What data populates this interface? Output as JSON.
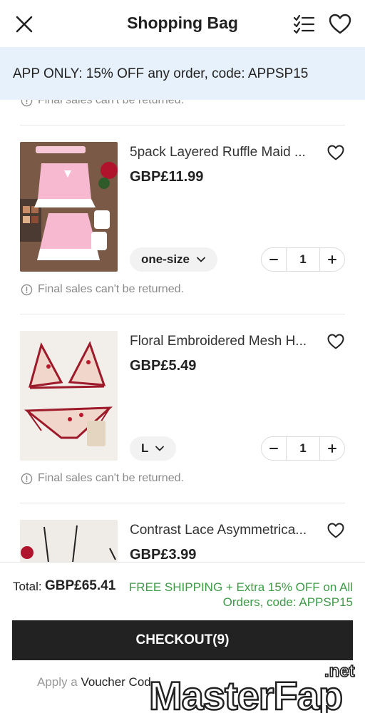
{
  "header": {
    "title": "Shopping Bag",
    "close_icon": "close-icon",
    "list_icon": "checklist-icon",
    "wishlist_icon": "heart-icon"
  },
  "promo": {
    "text": "APP ONLY: 15% OFF any order, code: APPSP15",
    "background": "#e6f1fb"
  },
  "items": [
    {
      "name": "5pack Layered Ruffle Maid ...",
      "price": "GBP£11.99",
      "size": "one-size",
      "quantity": "1",
      "note": "Final sales can't be returned."
    },
    {
      "name": "Floral Embroidered Mesh H...",
      "price": "GBP£5.49",
      "size": "L",
      "quantity": "1",
      "note": "Final sales can't be returned."
    },
    {
      "name": "Contrast Lace Asymmetrica...",
      "price": "GBP£3.99"
    }
  ],
  "top_note": "Final sales can't be returned.",
  "footer": {
    "total_label": "Total:",
    "total_value": "GBP£65.41",
    "free_shipping": "FREE SHIPPING + Extra 15% OFF on All Orders, code: APPSP15",
    "free_shipping_color": "#3d9a47",
    "checkout_label": "CHECKOUT(9)",
    "voucher_prefix": "Apply a",
    "voucher_link": "Voucher Cod"
  },
  "watermark": {
    "text_main": "MasterFap",
    "text_net": ".net"
  }
}
